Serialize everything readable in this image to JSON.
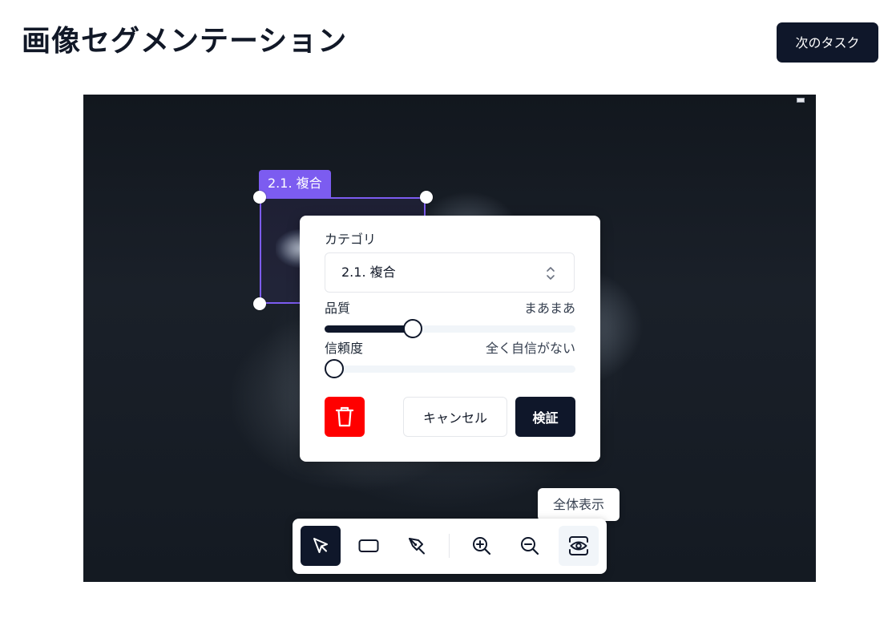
{
  "header": {
    "title": "画像セグメンテーション",
    "next_task_label": "次のタスク"
  },
  "annotation": {
    "label": "2.1. 複合",
    "color": "#7c5cf0"
  },
  "popover": {
    "category_label": "カテゴリ",
    "category_value": "2.1. 複合",
    "quality_label": "品質",
    "quality_value": "まあまあ",
    "quality_level": 0.35,
    "confidence_label": "信頼度",
    "confidence_value": "全く自信がない",
    "confidence_level": 0.0,
    "cancel_label": "キャンセル",
    "verify_label": "検証",
    "delete_icon": "trash-icon",
    "delete_color": "#ff0000"
  },
  "tooltip": {
    "text": "全体表示"
  },
  "toolbar": {
    "tools": [
      {
        "name": "select",
        "icon": "cursor-arrow-icon",
        "active": true
      },
      {
        "name": "rectangle",
        "icon": "rectangle-icon",
        "active": false
      },
      {
        "name": "pen",
        "icon": "pen-tool-icon",
        "active": false
      },
      {
        "name": "zoom-in",
        "icon": "zoom-in-icon",
        "active": false
      },
      {
        "name": "zoom-out",
        "icon": "zoom-out-icon",
        "active": false
      },
      {
        "name": "fit-view",
        "icon": "eye-frame-icon",
        "active": false
      }
    ]
  },
  "colors": {
    "primary_dark": "#0f172a",
    "accent": "#7c5cf0",
    "danger": "#ff0000"
  }
}
